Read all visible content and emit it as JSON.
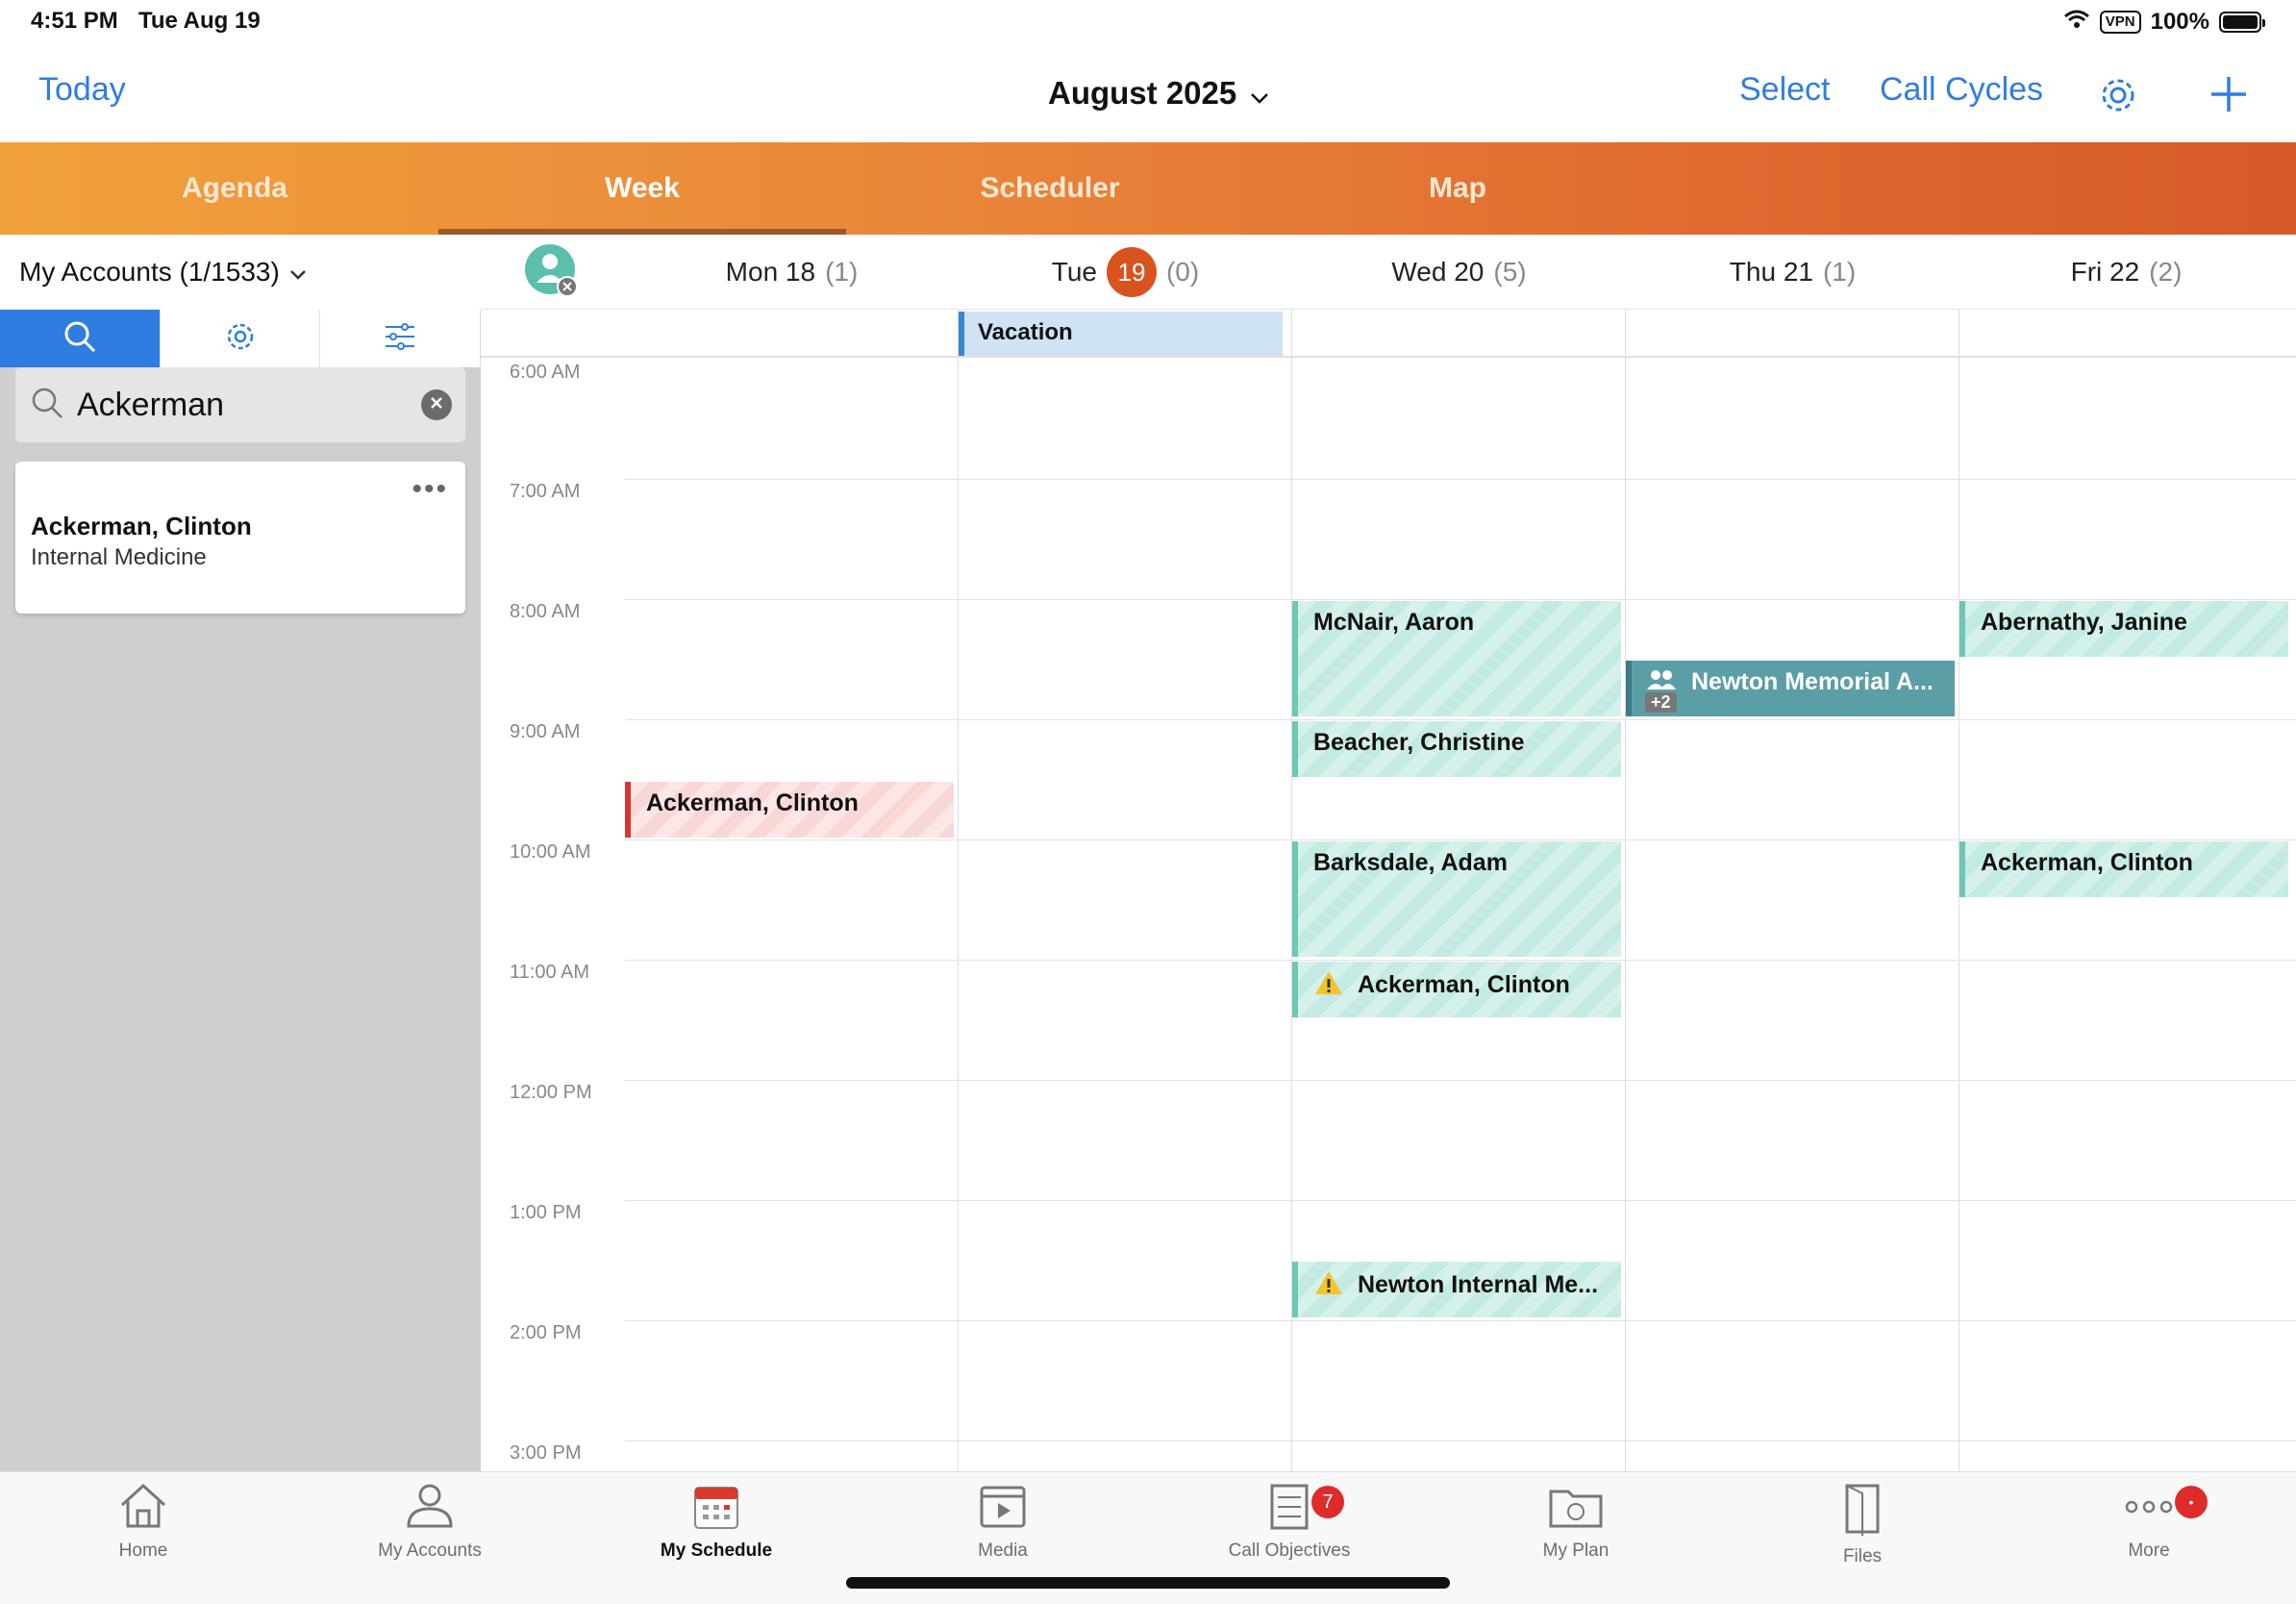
{
  "status_bar": {
    "time": "4:51 PM",
    "date": "Tue Aug 19",
    "vpn": "VPN",
    "battery": "100%"
  },
  "nav": {
    "today": "Today",
    "title": "August 2025",
    "select": "Select",
    "call_cycles": "Call Cycles"
  },
  "tabs": [
    "Agenda",
    "Week",
    "Scheduler",
    "Map"
  ],
  "active_tab": "Week",
  "left_panel": {
    "accounts_label": "My Accounts (1/1533)",
    "search_value": "Ackerman",
    "result": {
      "name": "Ackerman, Clinton",
      "specialty": "Internal Medicine",
      "more": "•••"
    }
  },
  "days": [
    {
      "label": "Mon 18",
      "count": "(1)"
    },
    {
      "label": "Tue",
      "number": "19",
      "count": "(0)"
    },
    {
      "label": "Wed 20",
      "count": "(5)"
    },
    {
      "label": "Thu 21",
      "count": "(1)"
    },
    {
      "label": "Fri 22",
      "count": "(2)"
    }
  ],
  "hours": [
    "6:00 AM",
    "7:00 AM",
    "8:00 AM",
    "9:00 AM",
    "10:00 AM",
    "11:00 AM",
    "12:00 PM",
    "1:00 PM",
    "2:00 PM",
    "3:00 PM"
  ],
  "all_day_event": {
    "title": "Vacation",
    "day": "Tue"
  },
  "events": [
    {
      "title": "Ackerman, Clinton",
      "day": "Mon 18",
      "start": "9:30 AM",
      "end": "10:00 AM",
      "kind": "red"
    },
    {
      "title": "McNair, Aaron",
      "day": "Wed 20",
      "start": "8:00 AM",
      "end": "9:00 AM",
      "kind": "teal"
    },
    {
      "title": "Beacher, Christine",
      "day": "Wed 20",
      "start": "9:00 AM",
      "end": "9:30 AM",
      "kind": "teal"
    },
    {
      "title": "Barksdale, Adam",
      "day": "Wed 20",
      "start": "10:00 AM",
      "end": "11:00 AM",
      "kind": "teal"
    },
    {
      "title": "Ackerman, Clinton",
      "day": "Wed 20",
      "start": "11:00 AM",
      "end": "11:30 AM",
      "kind": "teal",
      "warning": true
    },
    {
      "title": "Newton Internal Me...",
      "day": "Wed 20",
      "start": "1:30 PM",
      "end": "2:00 PM",
      "kind": "teal",
      "warning": true
    },
    {
      "title": "Newton Memorial A...",
      "day": "Thu 21",
      "start": "8:30 AM",
      "end": "9:00 AM",
      "kind": "group",
      "extra": "+2"
    },
    {
      "title": "Abernathy, Janine",
      "day": "Fri 22",
      "start": "8:00 AM",
      "end": "8:30 AM",
      "kind": "teal"
    },
    {
      "title": "Ackerman, Clinton",
      "day": "Fri 22",
      "start": "10:00 AM",
      "end": "10:30 AM",
      "kind": "teal"
    }
  ],
  "bottom_tabs": [
    {
      "label": "Home",
      "icon": "home-icon"
    },
    {
      "label": "My Accounts",
      "icon": "accounts-icon"
    },
    {
      "label": "My Schedule",
      "icon": "calendar-icon"
    },
    {
      "label": "Media",
      "icon": "media-icon"
    },
    {
      "label": "Call Objectives",
      "icon": "checklist-icon",
      "badge": "7"
    },
    {
      "label": "My Plan",
      "icon": "folder-icon"
    },
    {
      "label": "Files",
      "icon": "file-icon"
    },
    {
      "label": "More",
      "icon": "more-icon",
      "badge": "•"
    }
  ],
  "active_bottom_tab": "My Schedule",
  "colors": {
    "accent": "#2f7de1",
    "today_badge": "#d9531e",
    "teal": "#6dc7b5",
    "red": "#d93434",
    "group": "#5b9ea6",
    "vacation": "#cfe3f5"
  }
}
